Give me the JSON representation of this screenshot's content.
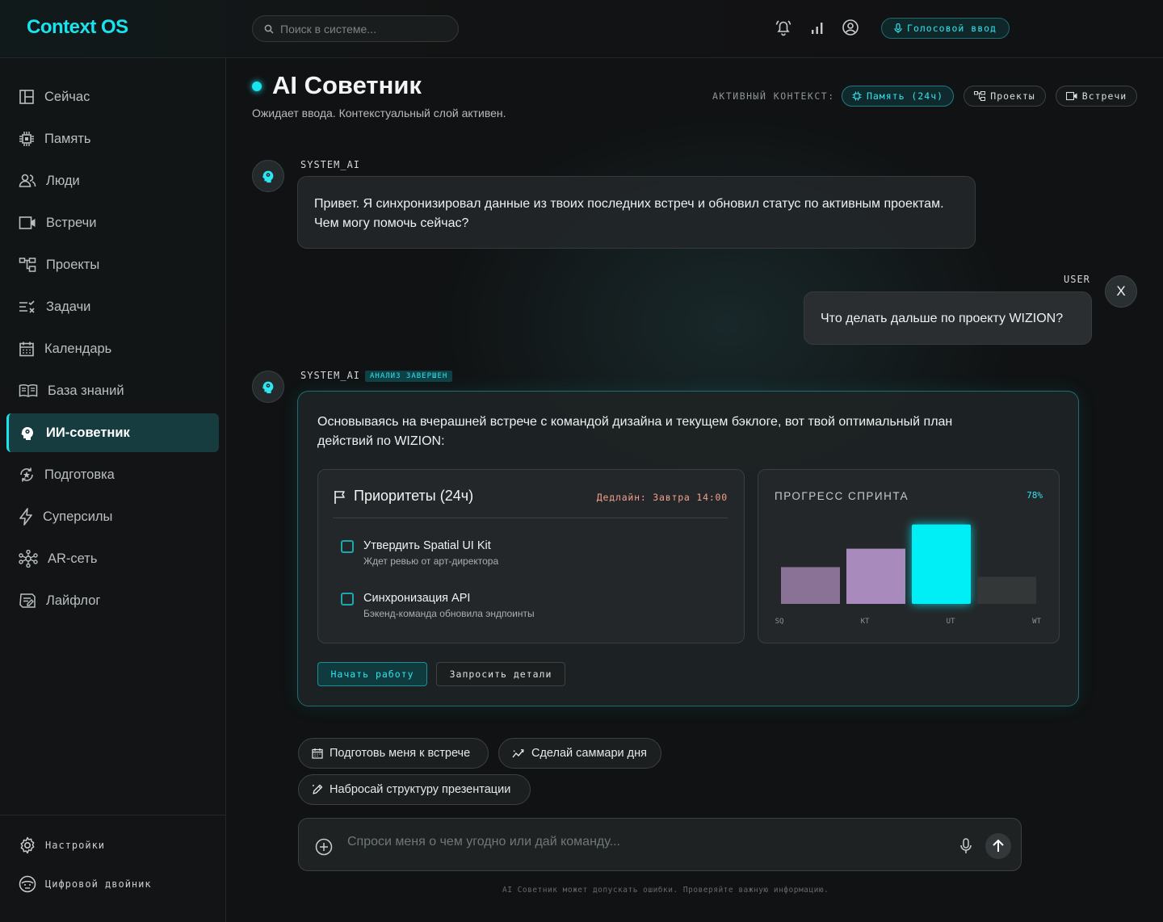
{
  "app": {
    "logo": "Context OS"
  },
  "search": {
    "placeholder": "Поиск в системе..."
  },
  "topbar": {
    "voice_label": "Голосовой ввод"
  },
  "sidebar": {
    "items": [
      {
        "label": "Сейчас",
        "icon": "layout-icon"
      },
      {
        "label": "Память",
        "icon": "chip-icon"
      },
      {
        "label": "Люди",
        "icon": "people-icon"
      },
      {
        "label": "Встречи",
        "icon": "video-icon"
      },
      {
        "label": "Проекты",
        "icon": "hierarchy-icon"
      },
      {
        "label": "Задачи",
        "icon": "checklist-icon"
      },
      {
        "label": "Календарь",
        "icon": "calendar-icon"
      },
      {
        "label": "База знаний",
        "icon": "book-icon"
      },
      {
        "label": "ИИ-советник",
        "icon": "ai-head-icon",
        "active": true
      },
      {
        "label": "Подготовка",
        "icon": "spin-icon"
      },
      {
        "label": "Суперсилы",
        "icon": "bolt-icon"
      },
      {
        "label": "AR-сеть",
        "icon": "network-icon"
      },
      {
        "label": "Лайфлог",
        "icon": "log-icon"
      }
    ],
    "bottom": [
      {
        "label": "Настройки",
        "icon": "gear-icon"
      },
      {
        "label": "Цифровой двойник",
        "icon": "twin-face-icon"
      }
    ]
  },
  "page": {
    "title": "AI Советник",
    "subtitle": "Ожидает ввода. Контекстуальный слой активен."
  },
  "context": {
    "label": "АКТИВНЫЙ КОНТЕКСТ:",
    "chips": [
      "Память (24ч)",
      "Проекты",
      "Встречи"
    ]
  },
  "chat": {
    "msg1": {
      "sender": "SYSTEM_AI",
      "text": "Привет. Я синхронизировал данные из твоих последних встреч и обновил статус по активным проектам. Чем могу помочь сейчас?"
    },
    "msg2": {
      "sender": "USER",
      "text": "Что делать дальше по проекту WIZION?",
      "close": "X"
    },
    "msg3": {
      "sender": "SYSTEM_AI",
      "badge": "АНАЛИЗ ЗАВЕРШЕН",
      "text": "Основываясь на вчерашней встрече с командой дизайна и текущем бэклоге, вот твой оптимальный план действий по WIZION:",
      "priorities": {
        "title": "Приоритеты (24ч)",
        "deadline": "Дедлайн: Завтра 14:00",
        "tasks": [
          {
            "title": "Утвердить Spatial UI Kit",
            "sub": "Ждет ревью от арт-директора"
          },
          {
            "title": "Синхронизация API",
            "sub": "Бэкенд-команда обновила эндпоинты"
          }
        ]
      },
      "sprint": {
        "title": "ПРОГРЕСС СПРИНТА",
        "percent": "78%"
      },
      "actions": {
        "primary": "Начать работу",
        "secondary": "Запросить детали"
      }
    }
  },
  "chart_data": {
    "type": "bar",
    "categories": [
      "SQ",
      "KT",
      "UT",
      "WT"
    ],
    "values": [
      38,
      57,
      82,
      28
    ],
    "ylim": [
      0,
      100
    ],
    "colors": [
      "#8a7296",
      "#a88abd",
      "#00eef6",
      "#333738"
    ],
    "title": "ПРОГРЕСС СПРИНТА"
  },
  "suggestions": [
    {
      "label": "Подготовь меня к встрече",
      "icon": "calendar-icon"
    },
    {
      "label": "Сделай саммари дня",
      "icon": "trend-icon"
    },
    {
      "label": "Набросай структуру презентации",
      "icon": "edit-icon"
    }
  ],
  "composer": {
    "placeholder": "Спроси меня о чем угодно или дай команду...",
    "disclaimer": "AI Советник может допускать ошибки. Проверяйте важную информацию."
  },
  "colors": {
    "accent": "#19e3ef",
    "deadline": "#f0a08c"
  }
}
